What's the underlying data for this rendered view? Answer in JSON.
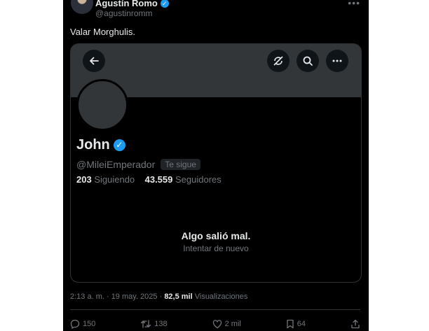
{
  "tweet": {
    "author_name": "Agustín Romo",
    "author_handle": "@agustinromm",
    "text": "Valar Morghulis.",
    "timestamp": "2:13 a. m. · 19 may. 2025 ·",
    "views_count": "82,5 mil",
    "views_label": "Visualizaciones"
  },
  "embedded_profile": {
    "name": "John",
    "handle": "@MileiEmperador",
    "follows_badge": "Te sigue",
    "following_count": "203",
    "following_label": "Siguiendo",
    "followers_count": "43.559",
    "followers_label": "Seguidores",
    "error_title": "Algo salió mal.",
    "retry_label": "Intentar de nuevo"
  },
  "actions": {
    "reply_count": "150",
    "retweet_count": "138",
    "like_count": "2 mil",
    "bookmark_count": "64"
  },
  "colors": {
    "background": "#000000",
    "accent": "#1d9bf0",
    "muted_text": "#71767b",
    "banner": "#333639"
  },
  "icons": [
    "back-arrow-icon",
    "no-sync-icon",
    "search-icon",
    "more-icon",
    "verified-icon",
    "reply-icon",
    "retweet-icon",
    "like-icon",
    "bookmark-icon",
    "share-icon"
  ]
}
